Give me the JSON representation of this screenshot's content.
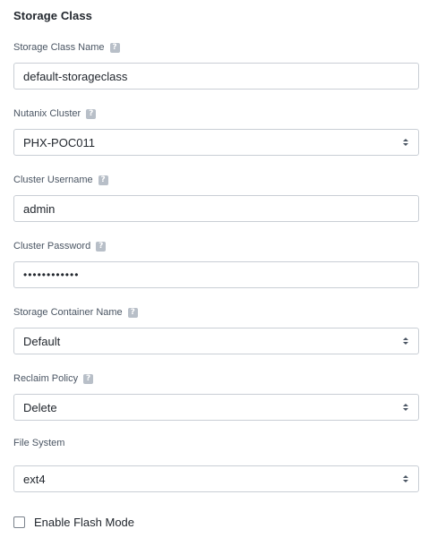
{
  "section": {
    "title": "Storage Class"
  },
  "fields": {
    "storage_class_name": {
      "label": "Storage Class Name",
      "value": "default-storageclass"
    },
    "nutanix_cluster": {
      "label": "Nutanix Cluster",
      "value": "PHX-POC011"
    },
    "cluster_username": {
      "label": "Cluster Username",
      "value": "admin"
    },
    "cluster_password": {
      "label": "Cluster Password",
      "value": "••••••••••••"
    },
    "storage_container_name": {
      "label": "Storage Container Name",
      "value": "Default"
    },
    "reclaim_policy": {
      "label": "Reclaim Policy",
      "value": "Delete"
    },
    "file_system": {
      "label": "File System",
      "value": "ext4"
    }
  },
  "help_icon_glyph": "?",
  "flash_mode": {
    "label": "Enable Flash Mode",
    "checked": false
  }
}
